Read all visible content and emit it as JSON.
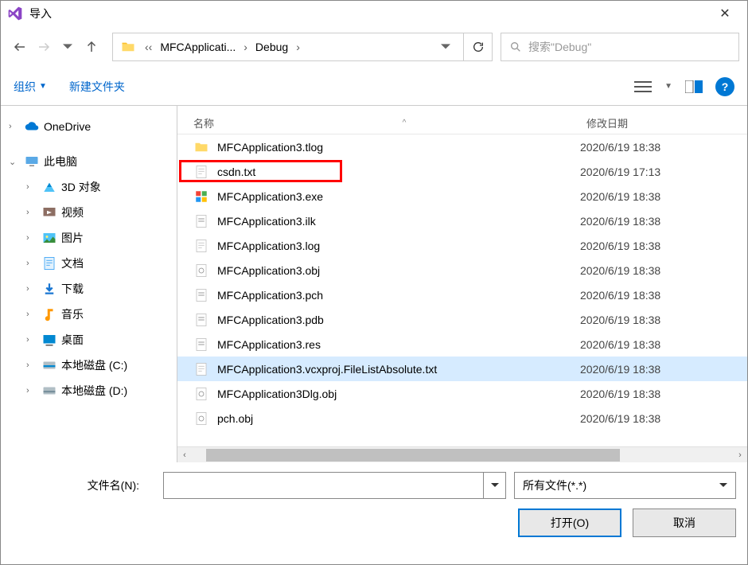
{
  "title": "导入",
  "breadcrumb": {
    "parts": [
      "MFCApplicati...",
      "Debug"
    ]
  },
  "search_placeholder": "搜索\"Debug\"",
  "toolbar": {
    "organize": "组织",
    "newfolder": "新建文件夹"
  },
  "sidebar": {
    "onedrive": "OneDrive",
    "thispc": "此电脑",
    "items": [
      "3D 对象",
      "视频",
      "图片",
      "文档",
      "下载",
      "音乐",
      "桌面",
      "本地磁盘 (C:)",
      "本地磁盘 (D:)"
    ]
  },
  "columns": {
    "name": "名称",
    "date": "修改日期"
  },
  "files": [
    {
      "name": "MFCApplication3.tlog",
      "date": "2020/6/19 18:38",
      "icon": "folder"
    },
    {
      "name": "csdn.txt",
      "date": "2020/6/19 17:13",
      "icon": "txt"
    },
    {
      "name": "MFCApplication3.exe",
      "date": "2020/6/19 18:38",
      "icon": "exe"
    },
    {
      "name": "MFCApplication3.ilk",
      "date": "2020/6/19 18:38",
      "icon": "generic"
    },
    {
      "name": "MFCApplication3.log",
      "date": "2020/6/19 18:38",
      "icon": "txt"
    },
    {
      "name": "MFCApplication3.obj",
      "date": "2020/6/19 18:38",
      "icon": "obj"
    },
    {
      "name": "MFCApplication3.pch",
      "date": "2020/6/19 18:38",
      "icon": "generic"
    },
    {
      "name": "MFCApplication3.pdb",
      "date": "2020/6/19 18:38",
      "icon": "generic"
    },
    {
      "name": "MFCApplication3.res",
      "date": "2020/6/19 18:38",
      "icon": "generic"
    },
    {
      "name": "MFCApplication3.vcxproj.FileListAbsolute.txt",
      "date": "2020/6/19 18:38",
      "icon": "txt",
      "selected": true
    },
    {
      "name": "MFCApplication3Dlg.obj",
      "date": "2020/6/19 18:38",
      "icon": "obj"
    },
    {
      "name": "pch.obj",
      "date": "2020/6/19 18:38",
      "icon": "obj"
    }
  ],
  "filename_label": "文件名(N):",
  "filter": "所有文件(*.*)",
  "buttons": {
    "open": "打开(O)",
    "cancel": "取消"
  },
  "filename_value": "",
  "highlight_index": 1
}
